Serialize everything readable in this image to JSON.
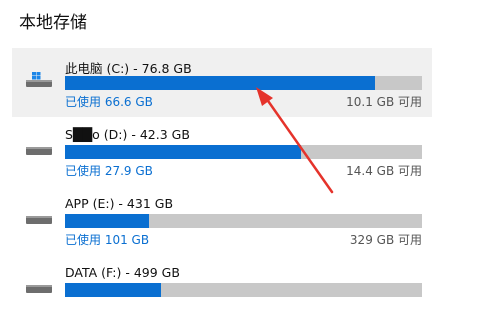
{
  "section_title": "本地存储",
  "drives": [
    {
      "name": "此电脑 (C:) - 76.8 GB",
      "used_label": "已使用 66.6 GB",
      "free_label": "10.1 GB 可用",
      "used_fraction": 0.867,
      "icon": "windows-drive-icon",
      "selected": true
    },
    {
      "name": "S██o (D:) - 42.3 GB",
      "used_label": "已使用 27.9 GB",
      "free_label": "14.4 GB 可用",
      "used_fraction": 0.66,
      "icon": "drive-icon",
      "selected": false
    },
    {
      "name": "APP (E:) - 431 GB",
      "used_label": "已使用 101 GB",
      "free_label": "329 GB 可用",
      "used_fraction": 0.234,
      "icon": "drive-icon",
      "selected": false
    },
    {
      "name": "DATA (F:) - 499 GB",
      "used_label": "",
      "free_label": "",
      "used_fraction": 0.27,
      "icon": "drive-icon",
      "selected": false
    }
  ],
  "colors": {
    "accent": "#0a6fd1",
    "bar_track": "#c8c8c8",
    "annotation": "#e5332b"
  }
}
